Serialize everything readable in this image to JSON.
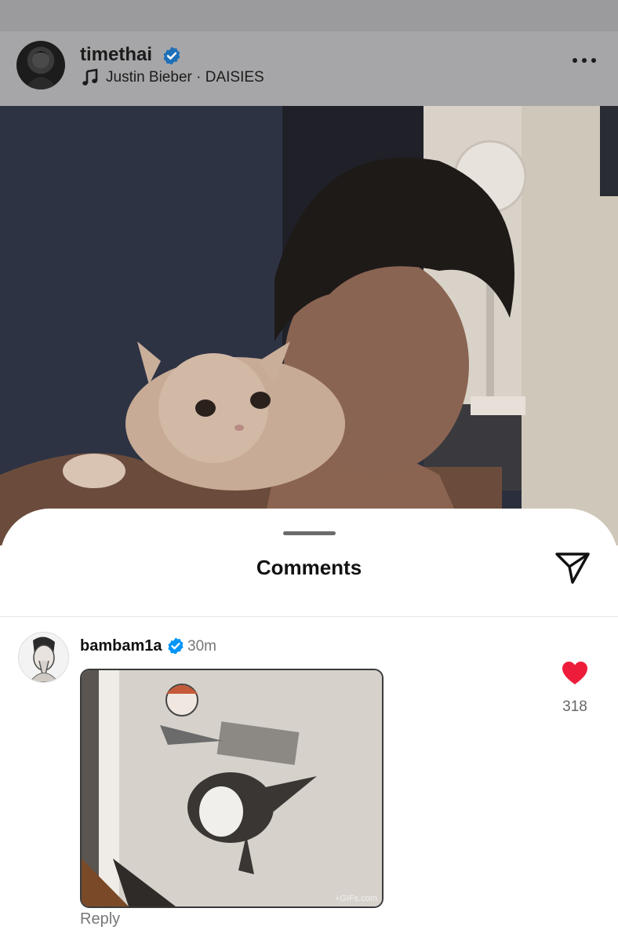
{
  "post": {
    "username": "timethai",
    "song": "Justin Bieber · DAISIES",
    "icons": {
      "verified": "verified-badge-icon",
      "music": "music-note-icon",
      "more": "more-options-icon"
    }
  },
  "comments_sheet": {
    "title": "Comments",
    "share_icon": "paper-plane-icon",
    "comment": {
      "username": "bambam1a",
      "time": "30m",
      "gif_watermark": "+GIFs.com",
      "reply_label": "Reply",
      "like_count": "318",
      "heart_color": "#ed1d3a"
    }
  },
  "colors": {
    "verified_blue": "#0095f6",
    "heart_red": "#ed1d3a"
  }
}
